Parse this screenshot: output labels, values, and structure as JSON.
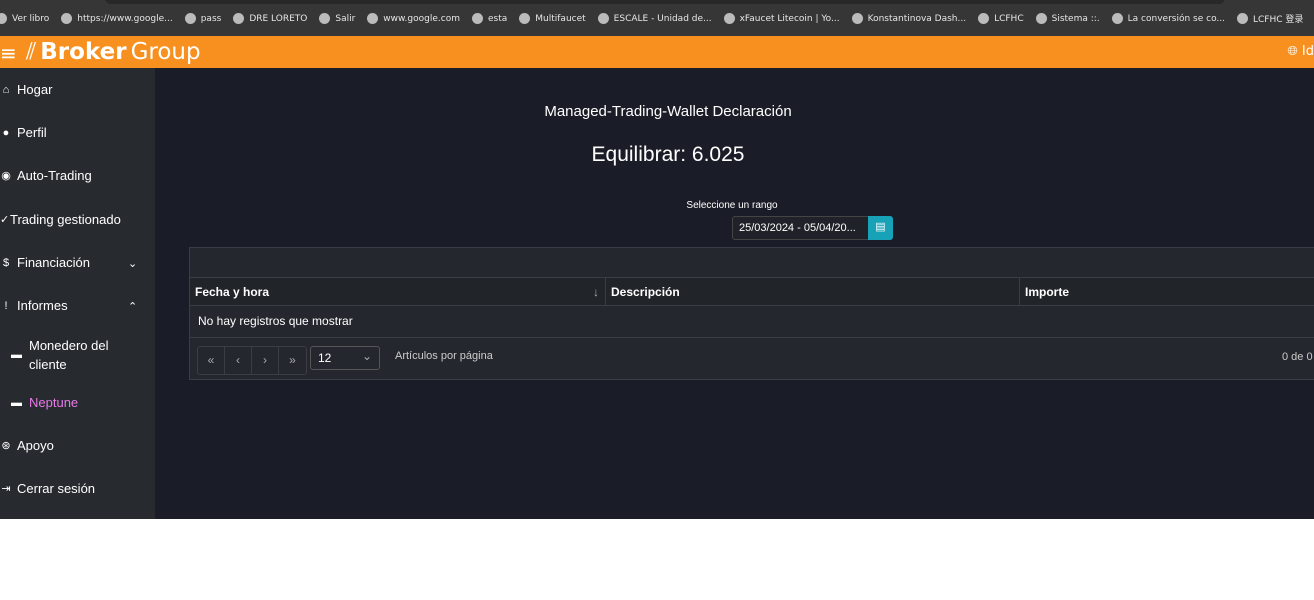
{
  "bookmarks": [
    "Ver libro",
    "https://www.google...",
    "pass",
    "DRE LORETO",
    "Salir",
    "www.google.com",
    "esta",
    "Multifaucet",
    "ESCALE - Unidad de...",
    "xFaucet Litecoin | Yo...",
    "Konstantinova Dash...",
    "LCFHC",
    "Sistema ::.",
    "La conversión se co...",
    "LCFHC 登录"
  ],
  "header": {
    "brand_bold": "Broker",
    "brand_light": "Group",
    "lang": "Id"
  },
  "sidebar": {
    "items": [
      {
        "label": "Hogar",
        "icon": "home-icon"
      },
      {
        "label": "Perfil",
        "icon": "user-icon"
      },
      {
        "label": "Auto-Trading",
        "icon": "robot-icon"
      },
      {
        "label": "Trading gestionado",
        "icon": "chart-icon"
      },
      {
        "label": "Financiación",
        "icon": "dollar-icon"
      },
      {
        "label": "Informes",
        "icon": "alert-icon"
      },
      {
        "label": "Monedero del cliente",
        "icon": "wallet-icon"
      },
      {
        "label": "Neptune",
        "icon": "wallet-icon"
      },
      {
        "label": "Apoyo",
        "icon": "support-icon"
      },
      {
        "label": "Cerrar sesión",
        "icon": "logout-icon"
      }
    ],
    "active_color": "#e879e8"
  },
  "main": {
    "title": "Managed-Trading-Wallet Declaración",
    "balance": "Equilibrar: 6.025",
    "range_label": "Seleccione un rango",
    "range_value": "25/03/2024 - 05/04/20...",
    "table": {
      "columns": [
        "Fecha y hora",
        "Descripción",
        "Importe"
      ],
      "empty": "No hay registros que mostrar",
      "per_page": "12",
      "per_page_label": "Artículos por página",
      "count": "0 de 0",
      "pager": [
        "«",
        "‹",
        "›",
        "»"
      ]
    }
  },
  "colors": {
    "header": "#f7901e",
    "accent": "#17a2b8"
  }
}
